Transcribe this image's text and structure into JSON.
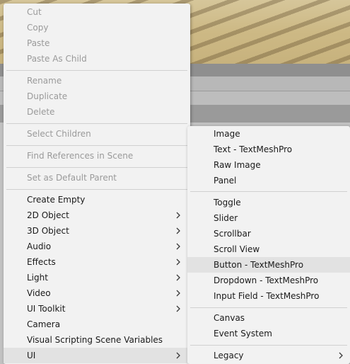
{
  "main_menu": {
    "items": [
      {
        "label": "Cut",
        "enabled": false
      },
      {
        "label": "Copy",
        "enabled": false
      },
      {
        "label": "Paste",
        "enabled": false
      },
      {
        "label": "Paste As Child",
        "enabled": false
      },
      {
        "label": "Rename",
        "enabled": false
      },
      {
        "label": "Duplicate",
        "enabled": false
      },
      {
        "label": "Delete",
        "enabled": false
      },
      {
        "label": "Select Children",
        "enabled": false
      },
      {
        "label": "Find References in Scene",
        "enabled": false
      },
      {
        "label": "Set as Default Parent",
        "enabled": false
      },
      {
        "label": "Create Empty",
        "enabled": true
      },
      {
        "label": "2D Object",
        "enabled": true,
        "submenu": true
      },
      {
        "label": "3D Object",
        "enabled": true,
        "submenu": true
      },
      {
        "label": "Audio",
        "enabled": true,
        "submenu": true
      },
      {
        "label": "Effects",
        "enabled": true,
        "submenu": true
      },
      {
        "label": "Light",
        "enabled": true,
        "submenu": true
      },
      {
        "label": "Video",
        "enabled": true,
        "submenu": true
      },
      {
        "label": "UI Toolkit",
        "enabled": true,
        "submenu": true
      },
      {
        "label": "Camera",
        "enabled": true
      },
      {
        "label": "Visual Scripting Scene Variables",
        "enabled": true
      },
      {
        "label": "UI",
        "enabled": true,
        "submenu": true,
        "highlighted": true
      }
    ]
  },
  "ui_submenu": {
    "items": [
      {
        "label": "Image"
      },
      {
        "label": "Text - TextMeshPro"
      },
      {
        "label": "Raw Image"
      },
      {
        "label": "Panel"
      },
      {
        "label": "Toggle"
      },
      {
        "label": "Slider"
      },
      {
        "label": "Scrollbar"
      },
      {
        "label": "Scroll View"
      },
      {
        "label": "Button - TextMeshPro",
        "highlighted": true
      },
      {
        "label": "Dropdown - TextMeshPro"
      },
      {
        "label": "Input Field - TextMeshPro"
      },
      {
        "label": "Canvas"
      },
      {
        "label": "Event System"
      },
      {
        "label": "Legacy",
        "submenu": true
      }
    ]
  },
  "icons": {
    "submenu_arrow": "chevron-right-icon"
  },
  "colors": {
    "menu_bg": "#f2f2f2",
    "disabled_text": "#9a9a9a",
    "highlight": "#e2e2e2"
  }
}
